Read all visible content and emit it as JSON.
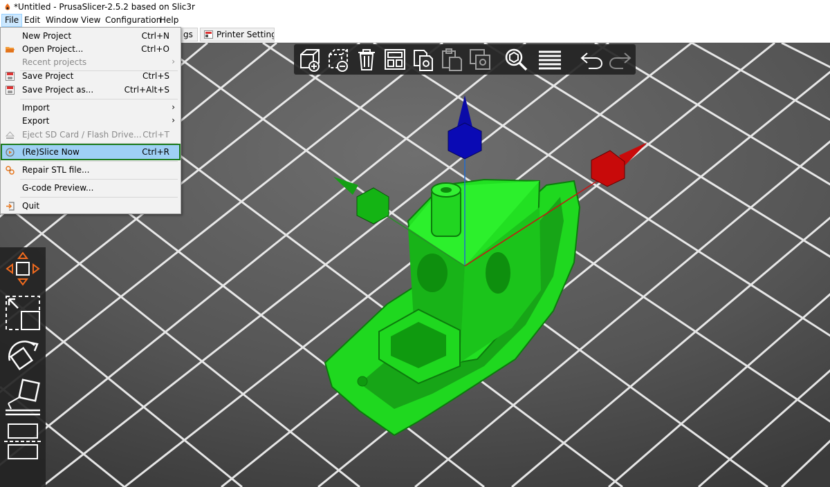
{
  "window": {
    "title": "*Untitled - PrusaSlicer-2.5.2 based on Slic3r"
  },
  "menubar": {
    "items": [
      "File",
      "Edit",
      "Window",
      "View",
      "Configuration",
      "Help"
    ]
  },
  "tabs": {
    "partial_label": "gs",
    "printer_settings": "Printer Settings"
  },
  "file_menu": {
    "new_project": {
      "label": "New Project",
      "shortcut": "Ctrl+N"
    },
    "open_project": {
      "label": "Open Project...",
      "shortcut": "Ctrl+O"
    },
    "recent_projects": {
      "label": "Recent projects",
      "arrow": "›"
    },
    "save_project": {
      "label": "Save Project",
      "shortcut": "Ctrl+S"
    },
    "save_project_as": {
      "label": "Save Project as...",
      "shortcut": "Ctrl+Alt+S"
    },
    "import": {
      "label": "Import",
      "arrow": "›"
    },
    "export": {
      "label": "Export",
      "arrow": "›"
    },
    "eject": {
      "label": "Eject SD Card / Flash Drive...",
      "shortcut": "Ctrl+T"
    },
    "reslice": {
      "label": "(Re)Slice Now",
      "shortcut": "Ctrl+R"
    },
    "repair": {
      "label": "Repair STL file..."
    },
    "gcode_preview": {
      "label": "G-code Preview..."
    },
    "quit": {
      "label": "Quit"
    }
  },
  "colors": {
    "model": "#1fd81f",
    "axis_z": "#0a0ab4",
    "axis_x": "#c80a0a",
    "axis_y": "#14b414",
    "menu_highlight": "#9fd0f5",
    "highlight_border": "#1b7a1b"
  },
  "icons": {
    "top_toolbar": [
      "add-object-icon",
      "delete-object-icon",
      "delete-all-icon",
      "arrange-icon",
      "copy-icon",
      "paste-icon",
      "add-instance-icon",
      "search-icon",
      "layers-icon",
      "undo-icon",
      "redo-icon"
    ],
    "left_toolbar": [
      "move-icon",
      "scale-icon",
      "rotate-icon",
      "place-on-face-icon",
      "cut-icon"
    ]
  }
}
